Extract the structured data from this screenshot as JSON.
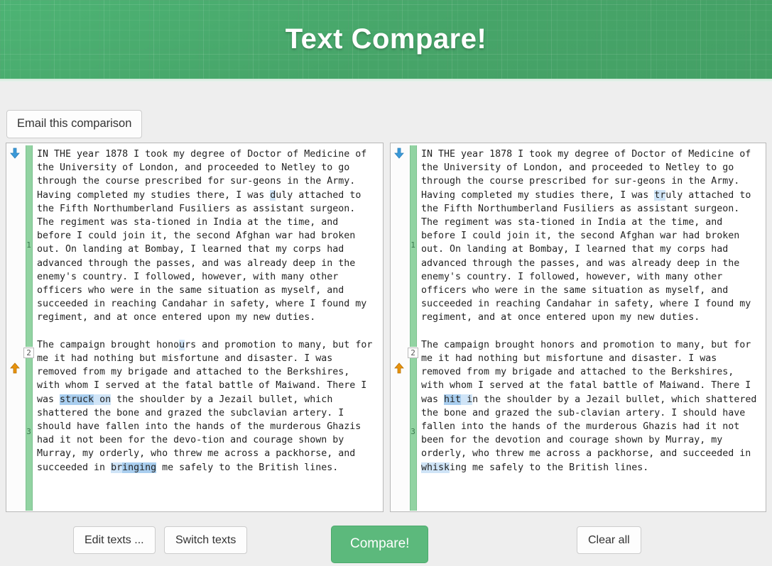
{
  "header": {
    "title": "Text Compare!",
    "brand_color": "#4aa96c"
  },
  "toolbar": {
    "email_label": "Email this comparison"
  },
  "footer": {
    "edit_label": "Edit texts ...",
    "switch_label": "Switch texts",
    "compare_label": "Compare!",
    "compare_color": "#5cb97c",
    "clear_label": "Clear all"
  },
  "gutter": {
    "numbers": [
      "1",
      "2",
      "3"
    ],
    "change_bar_color": "#92d3a2",
    "down_arrow_color": "#3b9ad9",
    "up_arrow_color": "#e8930c"
  },
  "highlight": {
    "light": "#cfe4f7",
    "deep": "#a9ceef"
  },
  "left_pane": {
    "paragraph1": {
      "before_hl": "IN THE year 1878 I took my degree of Doctor of Medicine of the University of London, and proceeded to Netley to go through the course prescribed for sur-geons in the Army. Having completed my studies there, I was ",
      "hl": "d",
      "after_hl": "uly attached to the Fifth Northumberland Fusiliers as assistant surgeon. The regiment was sta-tioned in India at the time, and before I could join it, the second Afghan war had broken out. On landing at Bombay, I learned that my corps had advanced through the passes, and was already deep in the enemy's country. I followed, however, with many other officers who were in the same situation as myself, and succeeded in reaching Candahar in safety, where I found my regiment, and at once entered upon my new duties."
    },
    "paragraph2": {
      "seg1": "The campaign brought hono",
      "seg2_hl": "u",
      "seg3": "rs and promotion to many, but for me it had nothing but misfortune and disaster. I was removed from my brigade and attached to the Berkshires, with whom I served at the fatal battle of Maiwand. There I was ",
      "seg4_hl_deep": "struck",
      "seg5_hl": " on",
      "seg6": " the shoulder by a Jezail bullet, which shattered the bone and grazed the subclavian artery. I should have fallen into the hands of the murderous Ghazis had it not been for the devo-tion and courage shown by Murray, my orderly, who threw me across a packhorse, and succeeded in ",
      "seg7_hl": "br",
      "seg8_hl_deep": "inging",
      "seg9": " me safely to the British lines."
    }
  },
  "right_pane": {
    "paragraph1": {
      "before_hl": "IN THE year 1878 I took my degree of Doctor of Medicine of the University of London, and proceeded to Netley to go through the course prescribed for sur-geons in the Army. Having completed my studies there, I was ",
      "hl": "tr",
      "after_hl": "uly attached to the Fifth Northumberland Fusiliers as assistant surgeon. The regiment was sta-tioned in India at the time, and before I could join it, the second Afghan war had broken out. On landing at Bombay, I learned that my corps had advanced through the passes, and was already deep in the enemy's country. I followed, however, with many other officers who were in the same situation as myself, and succeeded in reaching Candahar in safety, where I found my regiment, and at once entered upon my new duties."
    },
    "paragraph2": {
      "seg1": "The campaign brought honors and promotion to many, but for me it had nothing but misfortune and disaster. I was removed from my brigade and attached to the Berkshires, with whom I served at the fatal battle of Maiwand. There I was ",
      "seg2_hl_deep": "hit",
      "seg3_hl": " i",
      "seg4": "n the shoulder by a Jezail bullet, which shattered the bone and grazed the sub-clavian artery. I should have fallen into the hands of the murderous Ghazis had it not been for the devotion and courage shown by Murray, my orderly, who threw me across a packhorse, and succeeded in ",
      "seg5_hl": "whisk",
      "seg6": "ing me safely to the British lines."
    }
  }
}
